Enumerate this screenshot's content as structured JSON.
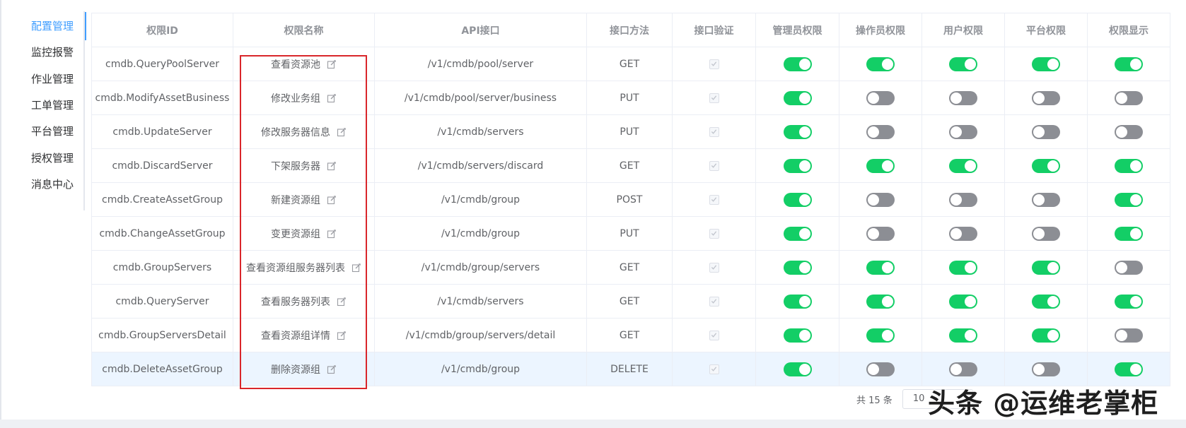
{
  "sidebar": {
    "items": [
      {
        "label": "配置管理",
        "active": true
      },
      {
        "label": "监控报警",
        "active": false
      },
      {
        "label": "作业管理",
        "active": false
      },
      {
        "label": "工单管理",
        "active": false
      },
      {
        "label": "平台管理",
        "active": false
      },
      {
        "label": "授权管理",
        "active": false
      },
      {
        "label": "消息中心",
        "active": false
      }
    ]
  },
  "table": {
    "headers": [
      "权限ID",
      "权限名称",
      "API接口",
      "接口方法",
      "接口验证",
      "管理员权限",
      "操作员权限",
      "用户权限",
      "平台权限",
      "权限显示"
    ],
    "rows": [
      {
        "id": "cmdb.QueryPoolServer",
        "name": "查看资源池",
        "api": "/v1/cmdb/pool/server",
        "method": "GET",
        "verified": true,
        "perms": [
          true,
          true,
          true,
          true,
          true
        ]
      },
      {
        "id": "cmdb.ModifyAssetBusiness",
        "name": "修改业务组",
        "api": "/v1/cmdb/pool/server/business",
        "method": "PUT",
        "verified": true,
        "perms": [
          true,
          false,
          false,
          false,
          false
        ]
      },
      {
        "id": "cmdb.UpdateServer",
        "name": "修改服务器信息",
        "api": "/v1/cmdb/servers",
        "method": "PUT",
        "verified": true,
        "perms": [
          true,
          false,
          false,
          false,
          false
        ]
      },
      {
        "id": "cmdb.DiscardServer",
        "name": "下架服务器",
        "api": "/v1/cmdb/servers/discard",
        "method": "GET",
        "verified": true,
        "perms": [
          true,
          true,
          true,
          true,
          true
        ]
      },
      {
        "id": "cmdb.CreateAssetGroup",
        "name": "新建资源组",
        "api": "/v1/cmdb/group",
        "method": "POST",
        "verified": true,
        "perms": [
          true,
          false,
          false,
          false,
          true
        ]
      },
      {
        "id": "cmdb.ChangeAssetGroup",
        "name": "变更资源组",
        "api": "/v1/cmdb/group",
        "method": "PUT",
        "verified": true,
        "perms": [
          true,
          false,
          false,
          false,
          true
        ]
      },
      {
        "id": "cmdb.GroupServers",
        "name": "查看资源组服务器列表",
        "api": "/v1/cmdb/group/servers",
        "method": "GET",
        "verified": true,
        "perms": [
          true,
          true,
          true,
          true,
          false
        ]
      },
      {
        "id": "cmdb.QueryServer",
        "name": "查看服务器列表",
        "api": "/v1/cmdb/servers",
        "method": "GET",
        "verified": true,
        "perms": [
          true,
          true,
          true,
          true,
          true
        ]
      },
      {
        "id": "cmdb.GroupServersDetail",
        "name": "查看资源组详情",
        "api": "/v1/cmdb/group/servers/detail",
        "method": "GET",
        "verified": true,
        "perms": [
          true,
          true,
          true,
          true,
          false
        ]
      },
      {
        "id": "cmdb.DeleteAssetGroup",
        "name": "删除资源组",
        "api": "/v1/cmdb/group",
        "method": "DELETE",
        "verified": true,
        "perms": [
          true,
          false,
          false,
          false,
          true
        ],
        "highlighted": true
      }
    ]
  },
  "pagination": {
    "total_label": "共 15 条",
    "page_size": "10"
  },
  "watermark": "头条 @运维老掌柜",
  "colors": {
    "accent": "#409eff",
    "switch_on": "#13ce66",
    "switch_off": "#8c8e94",
    "highlight_row": "#ecf5ff",
    "annotation_box": "#d9262b"
  }
}
